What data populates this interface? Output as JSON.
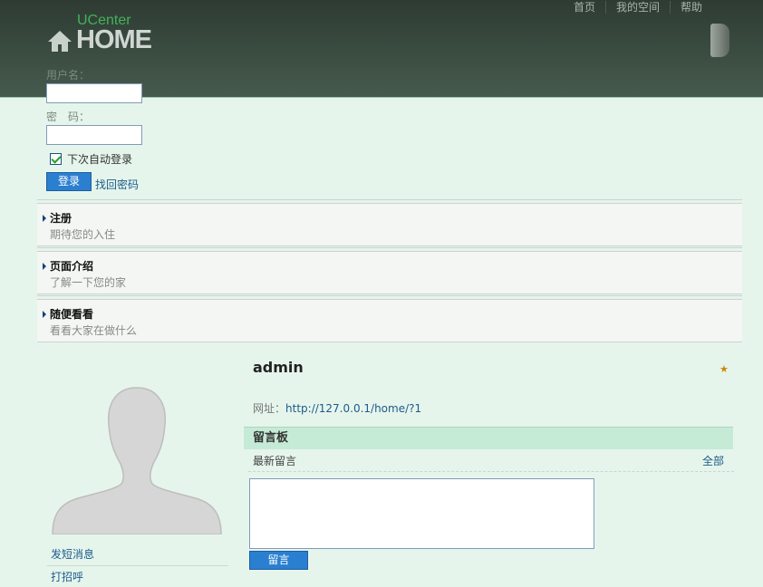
{
  "header": {
    "logo_small": "UCenter",
    "logo_big": "HOME",
    "nav": [
      "首页",
      "我的空间",
      "帮助"
    ]
  },
  "login": {
    "username_label": "用户名：",
    "username_value": "",
    "password_label": "密　码：",
    "password_value": "",
    "remember_label": "下次自动登录",
    "remember_checked": true,
    "submit_label": "登录",
    "forgot_label": "找回密码"
  },
  "boxes": [
    {
      "title": "注册",
      "desc": "期待您的入住"
    },
    {
      "title": "页面介绍",
      "desc": "了解一下您的家"
    },
    {
      "title": "随便看看",
      "desc": "看看大家在做什么"
    }
  ],
  "profile": {
    "username": "admin",
    "star_icon": "star-icon",
    "url_label": "网址：",
    "url": "http://127.0.0.1/home/?1",
    "side_links": [
      "发短消息",
      "打招呼"
    ]
  },
  "board": {
    "title": "留言板",
    "newest_label": "最新留言",
    "all_label": "全部",
    "textarea_value": "",
    "post_label": "留言"
  },
  "colors": {
    "header_bg": "#3c4e42",
    "page_bg": "#e6f5ec",
    "button_blue": "#2a7fd1",
    "link": "#1b5b8c",
    "board_title_bg": "#c5ebd6"
  }
}
